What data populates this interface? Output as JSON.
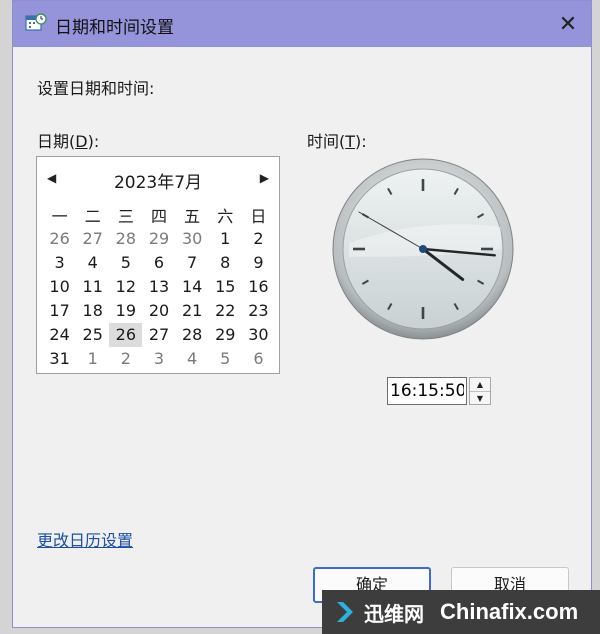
{
  "window": {
    "title": "日期和时间设置",
    "close_glyph": "✕"
  },
  "header": "设置日期和时间:",
  "date_label": {
    "text": "日期(",
    "key": "D",
    "tail": "):"
  },
  "time_label": {
    "text": "时间(",
    "key": "T",
    "tail": "):"
  },
  "calendar": {
    "month_title": "2023年7月",
    "prev_glyph": "◀",
    "next_glyph": "▶",
    "weekdays": [
      "一",
      "二",
      "三",
      "四",
      "五",
      "六",
      "日"
    ],
    "days": [
      {
        "d": "26",
        "other": true
      },
      {
        "d": "27",
        "other": true
      },
      {
        "d": "28",
        "other": true
      },
      {
        "d": "29",
        "other": true
      },
      {
        "d": "30",
        "other": true
      },
      {
        "d": "1"
      },
      {
        "d": "2"
      },
      {
        "d": "3"
      },
      {
        "d": "4"
      },
      {
        "d": "5"
      },
      {
        "d": "6"
      },
      {
        "d": "7"
      },
      {
        "d": "8"
      },
      {
        "d": "9"
      },
      {
        "d": "10"
      },
      {
        "d": "11"
      },
      {
        "d": "12"
      },
      {
        "d": "13"
      },
      {
        "d": "14"
      },
      {
        "d": "15"
      },
      {
        "d": "16"
      },
      {
        "d": "17"
      },
      {
        "d": "18"
      },
      {
        "d": "19"
      },
      {
        "d": "20"
      },
      {
        "d": "21"
      },
      {
        "d": "22"
      },
      {
        "d": "23"
      },
      {
        "d": "24"
      },
      {
        "d": "25"
      },
      {
        "d": "26",
        "selected": true
      },
      {
        "d": "27"
      },
      {
        "d": "28"
      },
      {
        "d": "29"
      },
      {
        "d": "30"
      },
      {
        "d": "31"
      },
      {
        "d": "1",
        "other": true
      },
      {
        "d": "2",
        "other": true
      },
      {
        "d": "3",
        "other": true
      },
      {
        "d": "4",
        "other": true
      },
      {
        "d": "5",
        "other": true
      },
      {
        "d": "6",
        "other": true
      }
    ]
  },
  "clock": {
    "hour": 16,
    "minute": 15,
    "second": 50
  },
  "time_value": "16:15:50",
  "spinner": {
    "up_glyph": "▲",
    "down_glyph": "▼"
  },
  "calendar_settings_link": "更改日历设置",
  "buttons": {
    "ok": "确定",
    "cancel": "取消"
  },
  "watermark": {
    "cn": "迅维网",
    "en": "Chinafix.com"
  },
  "colors": {
    "titlebar": "#9593d9",
    "link": "#1b4fa8",
    "ok_border": "#3d6bd6"
  }
}
